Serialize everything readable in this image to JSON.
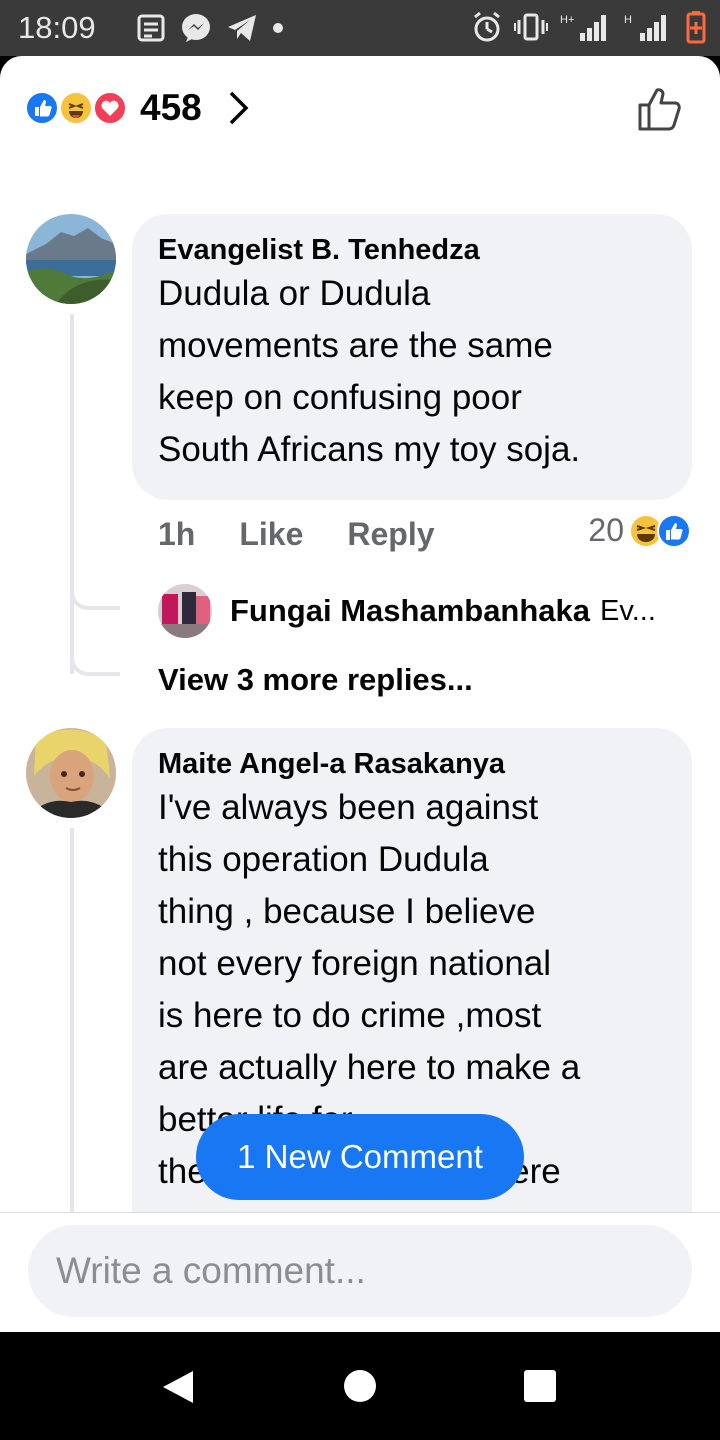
{
  "status_bar": {
    "time": "18:09",
    "left_icons": [
      "notes-icon",
      "messenger-icon",
      "telegram-icon",
      "dot-icon"
    ],
    "right_icons": [
      "alarm-icon",
      "vibrate-icon",
      "signal-h-plus-icon",
      "signal-h-icon",
      "battery-icon"
    ],
    "signal_label_1": "H+",
    "signal_label_2": "H"
  },
  "reactions": {
    "types": [
      "like",
      "haha",
      "love"
    ],
    "count": "458"
  },
  "comments": [
    {
      "author": "Evangelist B. Tenhedza",
      "text": "Dudula or Dudula\nmovements are the same\nkeep on confusing poor\nSouth Africans my toy soja.",
      "time": "1h",
      "like_label": "Like",
      "reply_label": "Reply",
      "reaction_count": "20",
      "reply_preview": {
        "author": "Fungai Mashambanhaka",
        "snippet": "Ev..."
      },
      "view_more": "View 3 more replies..."
    },
    {
      "author": "Maite Angel-a Rasakanya",
      "text": "I've always been against\nthis operation Dudula\nthing , because I believe\nnot every foreign national\nis here to do crime ,most\nare actually here to make a\nbetter life for\nthemselves, they are here"
    }
  ],
  "new_comment_pill": "1 New Comment",
  "composer": {
    "placeholder": "Write a comment..."
  },
  "colors": {
    "brand_blue": "#1877f2",
    "bubble_bg": "#f0f2f5",
    "meta_gray": "#65676b",
    "love_red": "#f33e58",
    "haha_yellow": "#f7c33c"
  }
}
